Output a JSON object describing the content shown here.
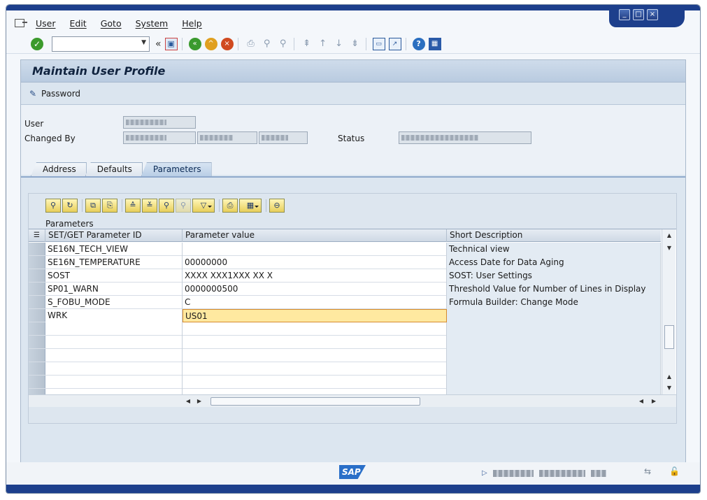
{
  "window": {
    "controls": [
      "minimize",
      "maximize",
      "close"
    ]
  },
  "menu": {
    "items": [
      "User",
      "Edit",
      "Goto",
      "System",
      "Help"
    ]
  },
  "toolbar": {
    "command_field_value": "",
    "icons": [
      "enter-icon",
      "save-icon",
      "back-icon",
      "exit-icon",
      "cancel-icon",
      "print-icon",
      "find-icon",
      "find-next-icon",
      "first-page-icon",
      "previous-page-icon",
      "next-page-icon",
      "last-page-icon",
      "create-session-icon",
      "shortcut-icon",
      "help-icon",
      "customize-layout-icon"
    ]
  },
  "screen": {
    "title": "Maintain User Profile",
    "password_button": "Password"
  },
  "form": {
    "user_label": "User",
    "changed_by_label": "Changed By",
    "status_label": "Status"
  },
  "tabs": [
    {
      "label": "Address",
      "active": false
    },
    {
      "label": "Defaults",
      "active": false
    },
    {
      "label": "Parameters",
      "active": true
    }
  ],
  "grid": {
    "title": "Parameters",
    "columns": [
      "SET/GET Parameter ID",
      "Parameter value",
      "Short Description"
    ],
    "rows": [
      {
        "id": "SE16N_TECH_VIEW",
        "value": "",
        "desc": "Technical view"
      },
      {
        "id": "SE16N_TEMPERATURE",
        "value": "00000000",
        "desc": "Access Date for Data Aging"
      },
      {
        "id": "SOST",
        "value": "XXXX    XXX1XXX  XX  X",
        "desc": "SOST: User Settings"
      },
      {
        "id": "SP01_WARN",
        "value": "0000000500",
        "desc": "Threshold Value for Number of Lines in Display"
      },
      {
        "id": "S_FOBU_MODE",
        "value": "C",
        "desc": "Formula Builder: Change Mode"
      },
      {
        "id": "WRK",
        "value": "US01",
        "desc": ""
      },
      {
        "id": "",
        "value": "",
        "desc": ""
      },
      {
        "id": "",
        "value": "",
        "desc": ""
      },
      {
        "id": "",
        "value": "",
        "desc": ""
      },
      {
        "id": "",
        "value": "",
        "desc": ""
      },
      {
        "id": "",
        "value": "",
        "desc": ""
      },
      {
        "id": "",
        "value": "",
        "desc": ""
      }
    ],
    "active_row_index": 5
  },
  "status_bar": {
    "logo": "SAP"
  }
}
